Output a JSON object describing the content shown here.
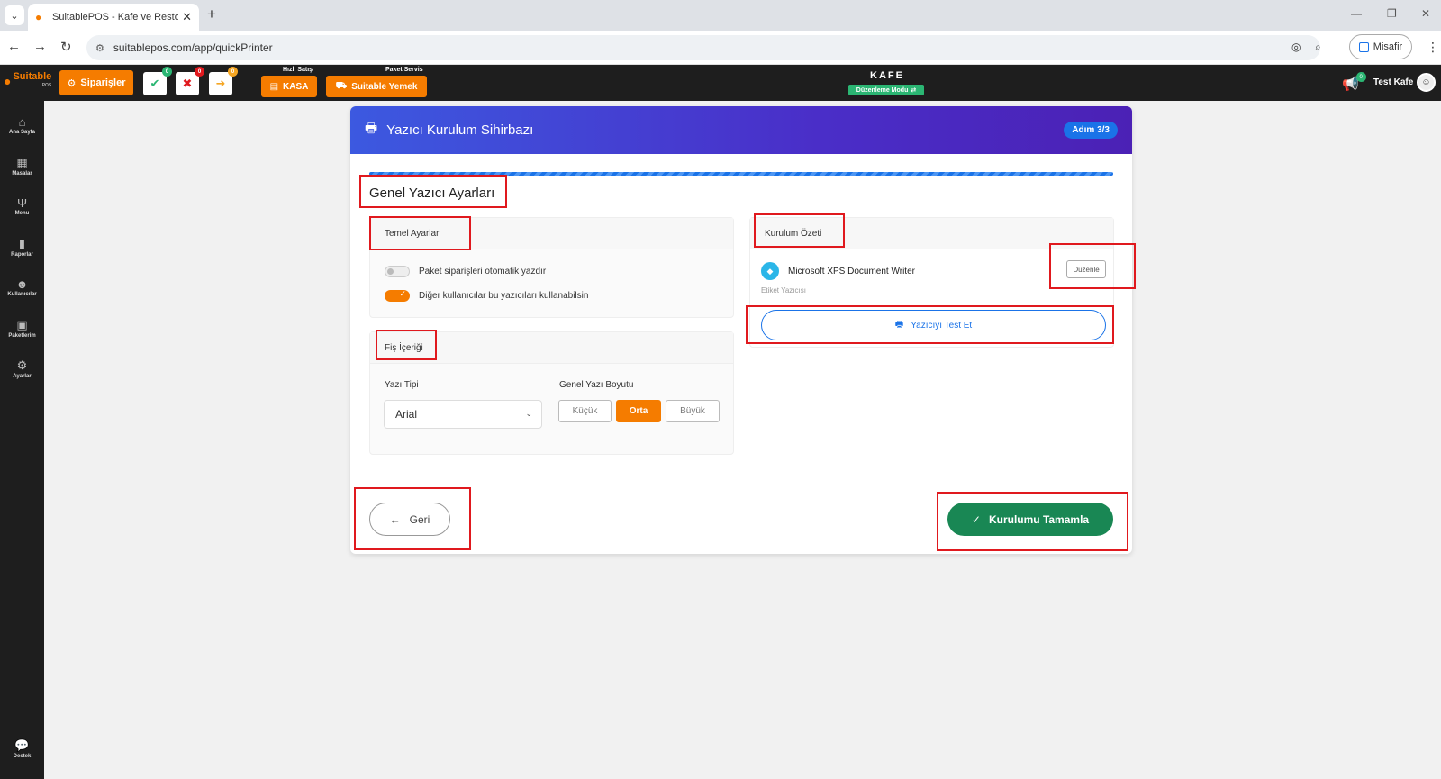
{
  "browser": {
    "tab_title": "SuitablePOS - Kafe ve Restoran",
    "url": "suitablepos.com/app/quickPrinter",
    "guest_label": "Misafir"
  },
  "appbar": {
    "logo_text": "Suitable",
    "logo_sub": "POS",
    "orders_label": "Siparişler",
    "badge_green": "0",
    "badge_red": "0",
    "badge_yellow": "0",
    "quick_sale_label": "Hızlı Satış",
    "kasa_label": "KASA",
    "package_service_label": "Paket Servis",
    "suitable_yemek_label": "Suitable Yemek",
    "venue_title": "KAFE",
    "edit_mode_label": "Düzenleme Modu",
    "notify_count": "0",
    "user_name": "Test Kafe"
  },
  "sidebar": {
    "items": [
      {
        "label": "Ana Sayfa"
      },
      {
        "label": "Masalar"
      },
      {
        "label": "Menu"
      },
      {
        "label": "Raporlar"
      },
      {
        "label": "Kullanıcılar"
      },
      {
        "label": "Paketlerim"
      },
      {
        "label": "Ayarlar"
      },
      {
        "label": "Destek"
      }
    ]
  },
  "wizard": {
    "title": "Yazıcı Kurulum Sihirbazı",
    "step": "Adım 3/3",
    "section_title": "Genel Yazıcı Ayarları",
    "basic": {
      "title": "Temel Ayarlar",
      "toggle1_label": "Paket siparişleri otomatik yazdır",
      "toggle2_label": "Diğer kullanıcılar bu yazıcıları kullanabilsin"
    },
    "receipt": {
      "title": "Fiş İçeriği",
      "font_label": "Yazı Tipi",
      "font_value": "Arial",
      "size_label": "Genel Yazı Boyutu",
      "size_small": "Küçük",
      "size_medium": "Orta",
      "size_large": "Büyük"
    },
    "summary": {
      "title": "Kurulum Özeti",
      "printer_name": "Microsoft XPS Document Writer",
      "printer_type": "Etiket Yazıcısı",
      "edit_label": "Düzenle",
      "test_label": "Yazıcıyı Test Et"
    },
    "back_label": "Geri",
    "finish_label": "Kurulumu Tamamla"
  },
  "colors": {
    "accent_orange": "#f57c00",
    "primary_blue": "#1a73e8",
    "success_green": "#198754",
    "highlight_red": "#e0191e"
  }
}
